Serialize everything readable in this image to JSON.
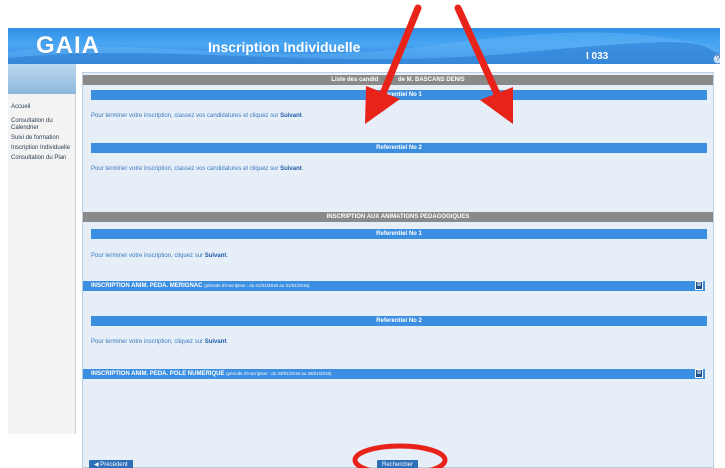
{
  "header": {
    "logo": "GAIA",
    "title": "Inscription Individuelle",
    "code": "I 033",
    "help_glyph": "?"
  },
  "sidebar": {
    "items": [
      {
        "label": "Accueil"
      },
      {
        "label": "Consultation du Calendrier"
      },
      {
        "label": "Suivi de formation"
      },
      {
        "label": "Inscription Individuelle"
      },
      {
        "label": "Consultation du Plan"
      }
    ]
  },
  "section1": {
    "title_prefix": "Liste des candid",
    "title_hidden": "atures",
    "title_suffix": "de ",
    "title_name": "M. BASCANS DENIS",
    "ref1": {
      "title": "Referentiel No 1",
      "info_text": "Pour terminer votre inscription, classez vos candidatures et cliquez sur ",
      "info_link": "Suivant",
      "info_end": "."
    },
    "ref2": {
      "title": "Referentiel No 2",
      "info_text": "Pour terminer votre inscription, classez vos candidatures et cliquez sur ",
      "info_link": "Suivant",
      "info_end": "."
    }
  },
  "section2": {
    "title": "INSCRIPTION AUX ANIMATIONS PEDAGOGIQUES",
    "ref1": {
      "title": "Referentiel No 1",
      "info_text": "Pour terminer votre inscription, cliquez sur ",
      "info_link": "Suivant",
      "info_end": ".",
      "row_label": "INSCRIPTION ANIM. PEDA. MERIGNAC",
      "row_period": "(période d'inscription : du 01/01/2016 au 31/01/2016)"
    },
    "ref2": {
      "title": "Referentiel No 2",
      "info_text": "Pour terminer votre inscription, cliquez sur ",
      "info_link": "Suivant",
      "info_end": ".",
      "row_label": "INSCRIPTION ANIM. PEDA. POLE NUMERIQUE",
      "row_period": "(période d'inscription : du 23/01/2016 au 28/01/2016)"
    }
  },
  "footer": {
    "prev_label": "◀ Précédent",
    "search_label": "Rechercher"
  },
  "annotations": {
    "arrow_color": "#e8231a",
    "circle_color": "#e8231a"
  }
}
